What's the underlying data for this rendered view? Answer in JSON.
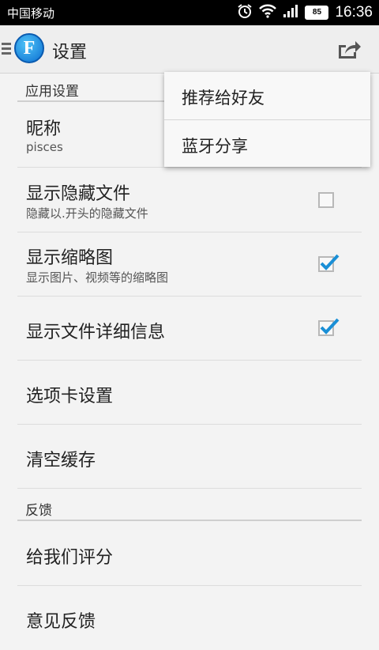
{
  "status_bar": {
    "carrier": "中国移动",
    "battery": "85",
    "time": "16:36"
  },
  "action_bar": {
    "title": "设置",
    "app_logo_letter": "F"
  },
  "sections": {
    "app_settings": "应用设置",
    "feedback": "反馈"
  },
  "items": {
    "nickname": {
      "title": "昵称",
      "subtitle": "pisces"
    },
    "show_hidden": {
      "title": "显示隐藏文件",
      "subtitle": "隐藏以.开头的隐藏文件",
      "checked": false
    },
    "show_thumbs": {
      "title": "显示缩略图",
      "subtitle": "显示图片、视频等的缩略图",
      "checked": true
    },
    "show_details": {
      "title": "显示文件详细信息",
      "checked": true
    },
    "tabs_settings": {
      "title": "选项卡设置"
    },
    "clear_cache": {
      "title": "清空缓存"
    },
    "rate_us": {
      "title": "给我们评分"
    },
    "feedback": {
      "title": "意见反馈"
    }
  },
  "popup_menu": {
    "recommend": "推荐给好友",
    "bluetooth": "蓝牙分享"
  },
  "colors": {
    "check_blue": "#1a8fd6",
    "status_bar": "#000000",
    "action_bar": "#eeeeee"
  }
}
